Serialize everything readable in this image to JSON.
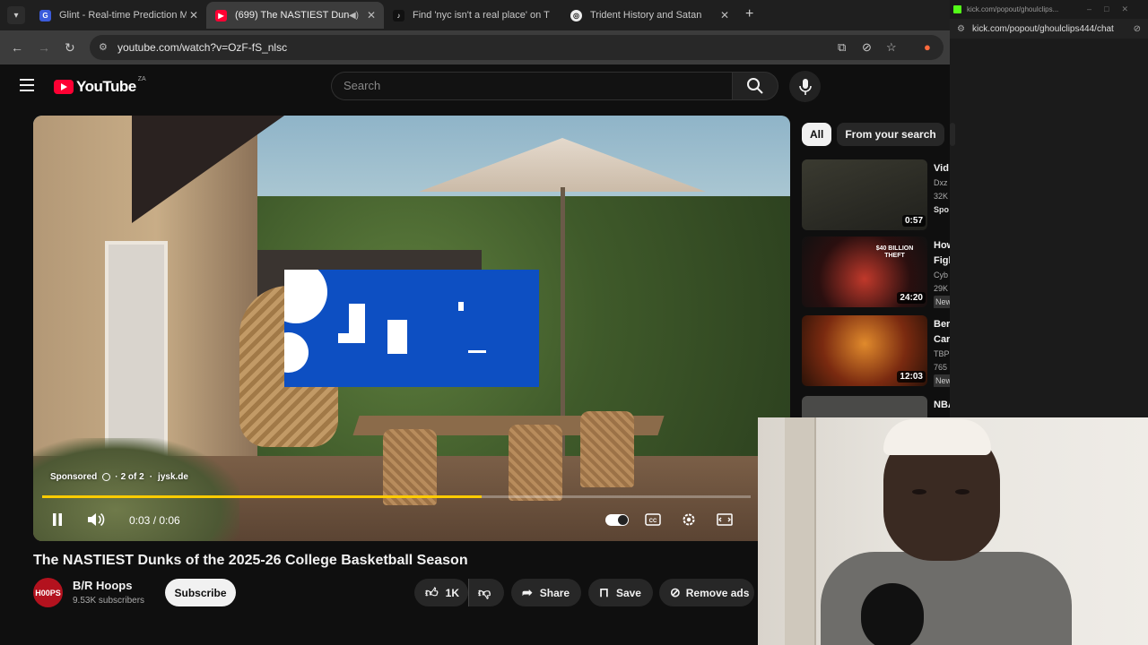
{
  "browser": {
    "tabs": [
      {
        "title": "Glint - Real-time Prediction Ma",
        "icon": "glint-icon"
      },
      {
        "title": "(699) The NASTIEST Dunks",
        "icon": "youtube-icon",
        "active": true
      },
      {
        "title": "Find 'nyc isn't a real place' on T",
        "icon": "tiktok-icon"
      },
      {
        "title": "Trident History and Satan",
        "icon": "chatgpt-icon"
      }
    ],
    "url": "youtube.com/watch?v=OzF-fS_nlsc"
  },
  "popout": {
    "tab_title": "kick.com/popout/ghoulclips...",
    "url": "kick.com/popout/ghoulclips444/chat"
  },
  "masthead": {
    "logo": "YouTube",
    "country": "ZA",
    "search_placeholder": "Search"
  },
  "player": {
    "ad_sponsored": "Sponsored",
    "ad_count": "2 of 2",
    "ad_domain": "jysk.de",
    "time": "0:03 / 0:06",
    "progress": 0.62,
    "progress_color": "#ffcc00"
  },
  "video": {
    "title": "The NASTIEST Dunks of the 2025-26 College Basketball Season",
    "channel": "B/R Hoops",
    "channel_avatar": "H00PS",
    "subscribers": "9.53K subscribers",
    "subscribe_label": "Subscribe",
    "likes": "1K",
    "share_label": "Share",
    "save_label": "Save",
    "remove_ads_label": "Remove ads"
  },
  "chips": [
    "All",
    "From your search"
  ],
  "recommendations": [
    {
      "title": "Vid",
      "line1": "Dxz",
      "line2": "32K",
      "line3": "Spo",
      "duration": "0:57",
      "thumb_color": "#2d2d28"
    },
    {
      "title": "How",
      "title2": "Figl",
      "line1": "Cyb",
      "line2": "29K",
      "line3": "New",
      "duration": "24:20",
      "thumb_color": "#1a1a1a",
      "thumb_text": "$40 BILLION THEFT"
    },
    {
      "title": "Ber",
      "title2": "Car",
      "line1": "TBP",
      "line2": "765",
      "line3": "New",
      "duration": "12:03",
      "thumb_color": "#5a2a14"
    },
    {
      "title": "NBA",
      "duration": "",
      "thumb_color": "#444"
    }
  ],
  "colors": {
    "youtube_red": "#ff0033",
    "background": "#0f0f0f",
    "ad_blue": "#0d4fc2"
  }
}
